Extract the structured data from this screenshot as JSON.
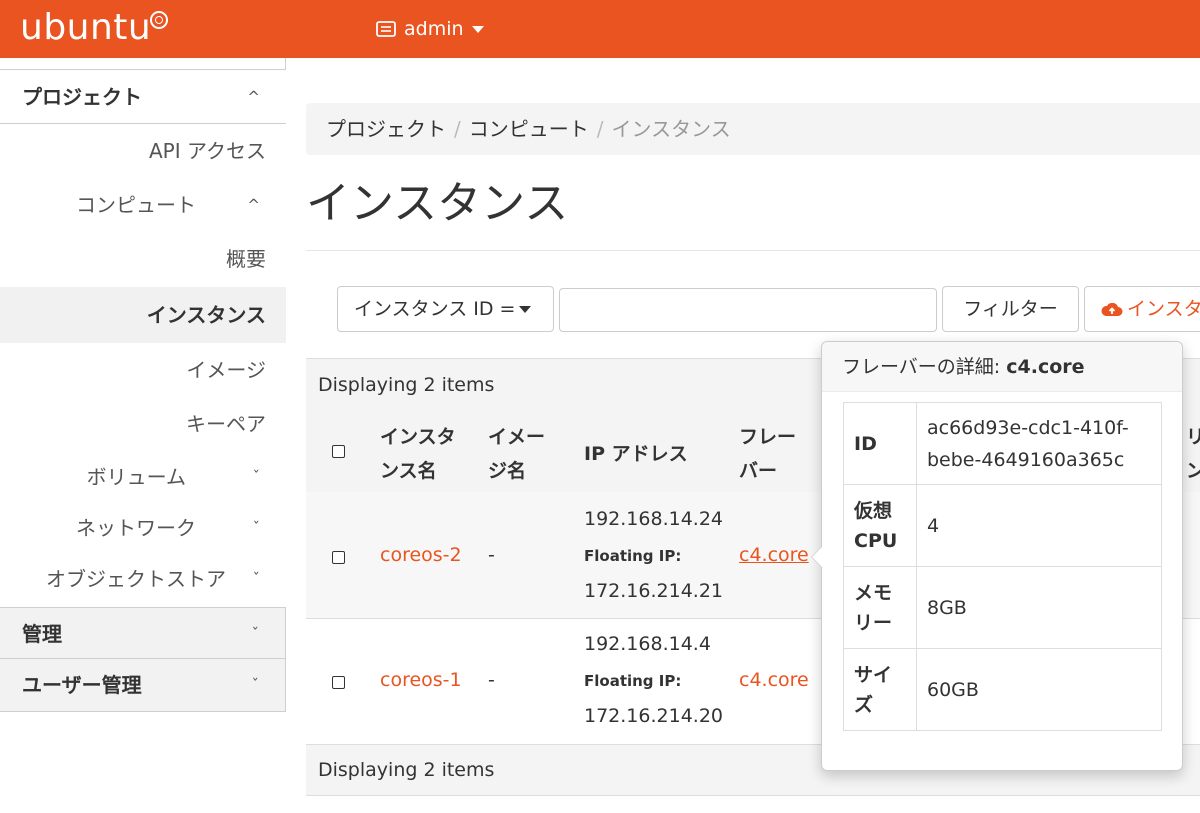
{
  "brand": {
    "logo_text": "ubuntu",
    "accent": "#e95420"
  },
  "header": {
    "project_label": "admin"
  },
  "sidebar": {
    "project_section": "プロジェクト",
    "api_access": "API アクセス",
    "compute_section": "コンピュート",
    "overview": "概要",
    "instances": "インスタンス",
    "images": "イメージ",
    "keypairs": "キーペア",
    "volumes": "ボリューム",
    "network": "ネットワーク",
    "object_store": "オブジェクトストア",
    "admin_section": "管理",
    "identity_section": "ユーザー管理"
  },
  "breadcrumb": {
    "project": "プロジェクト",
    "compute": "コンピュート",
    "current": "インスタンス",
    "separator": "/"
  },
  "page": {
    "title": "インスタンス"
  },
  "filter": {
    "field_label": "インスタンス ID =",
    "input_value": "",
    "filter_button": "フィルター",
    "launch_button": "インスタンスの起動"
  },
  "table": {
    "summary_top": "Displaying 2 items",
    "summary_bottom": "Displaying 2 items",
    "headers": {
      "name_l1": "インスタ",
      "name_l2": "ンス名",
      "image_l1": "イメー",
      "image_l2": "ジ名",
      "ip": "IP アドレス",
      "flavor_l1": "フレー",
      "flavor_l2": "バー",
      "clip_l1": "リ",
      "clip_l2": "ン"
    },
    "rows": [
      {
        "name": "coreos-2",
        "image": "-",
        "ip": "192.168.14.24",
        "floating_label": "Floating IP:",
        "floating_ip": "172.16.214.21",
        "flavor": "c4.core"
      },
      {
        "name": "coreos-1",
        "image": "-",
        "ip": "192.168.14.4",
        "floating_label": "Floating IP:",
        "floating_ip": "172.16.214.20",
        "flavor": "c4.core"
      }
    ]
  },
  "flavor_popover": {
    "title_prefix": "フレーバーの詳細: ",
    "title_name": "c4.core",
    "rows": [
      {
        "key_l1": "ID",
        "key_l2": "",
        "value_l1": "ac66d93e-cdc1-410f-",
        "value_l2": "bebe-4649160a365c"
      },
      {
        "key_l1": "仮想",
        "key_l2": "CPU",
        "value_l1": "4",
        "value_l2": ""
      },
      {
        "key_l1": "メモ",
        "key_l2": "リー",
        "value_l1": "8GB",
        "value_l2": ""
      },
      {
        "key_l1": "サイ",
        "key_l2": "ズ",
        "value_l1": "60GB",
        "value_l2": ""
      }
    ]
  }
}
